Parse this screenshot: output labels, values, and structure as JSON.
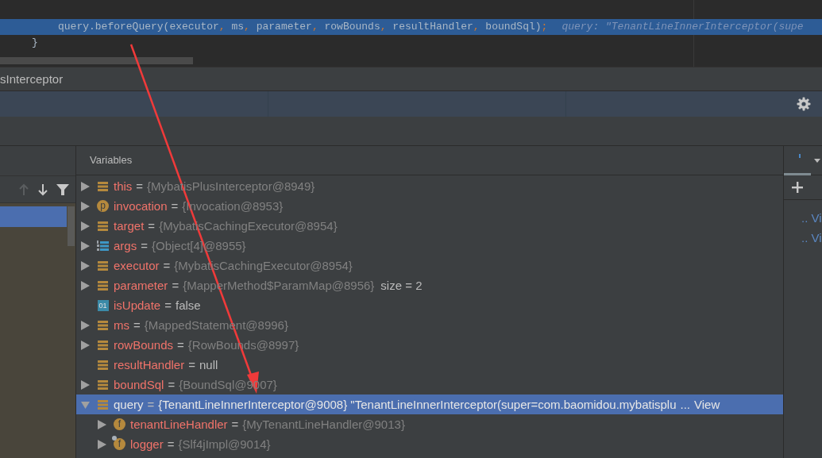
{
  "editor": {
    "lines": [
      {
        "current": true,
        "tokens": [
          {
            "kind": "plain",
            "text": "query.beforeQuery(executor"
          },
          {
            "kind": "comma",
            "text": ","
          },
          {
            "kind": "plain",
            "text": " ms"
          },
          {
            "kind": "comma",
            "text": ","
          },
          {
            "kind": "plain",
            "text": " parameter"
          },
          {
            "kind": "comma",
            "text": ","
          },
          {
            "kind": "plain",
            "text": " rowBounds"
          },
          {
            "kind": "comma",
            "text": ","
          },
          {
            "kind": "plain",
            "text": " resultHandler"
          },
          {
            "kind": "comma",
            "text": ","
          },
          {
            "kind": "plain",
            "text": " boundSql)"
          },
          {
            "kind": "comma",
            "text": ";"
          }
        ],
        "hint": "query: \"TenantLineInnerInterceptor(supe"
      },
      {
        "current": false,
        "tokens": [
          {
            "kind": "plain",
            "text": "}"
          }
        ]
      }
    ]
  },
  "file_tab": {
    "label": "sInterceptor"
  },
  "frames": {
    "rows": [
      {
        "selected": true
      }
    ]
  },
  "variables": {
    "title": "Variables",
    "rows": [
      {
        "name": "this",
        "eq": "=",
        "value": "{MybatisPlusInterceptor@8949}",
        "kind": "object",
        "expanded": false
      },
      {
        "name": "invocation",
        "eq": "=",
        "value": "{Invocation@8953}",
        "kind": "param",
        "icon_text": "p",
        "expanded": false
      },
      {
        "name": "target",
        "eq": "=",
        "value": "{MybatisCachingExecutor@8954}",
        "kind": "object",
        "expanded": false
      },
      {
        "name": "args",
        "eq": "=",
        "value": "{Object[4]@8955}",
        "kind": "array",
        "expanded": false
      },
      {
        "name": "executor",
        "eq": "=",
        "value": "{MybatisCachingExecutor@8954}",
        "kind": "object",
        "expanded": false
      },
      {
        "name": "parameter",
        "eq": "=",
        "value": "{MapperMethod$ParamMap@8956}",
        "extra": "size = 2",
        "kind": "object",
        "expanded": false
      },
      {
        "name": "isUpdate",
        "eq": "=",
        "value": "false",
        "literal": true,
        "kind": "primitive",
        "icon_text": "01"
      },
      {
        "name": "ms",
        "eq": "=",
        "value": "{MappedStatement@8996}",
        "kind": "object",
        "expanded": false
      },
      {
        "name": "rowBounds",
        "eq": "=",
        "value": "{RowBounds@8997}",
        "kind": "object",
        "expanded": false
      },
      {
        "name": "resultHandler",
        "eq": "=",
        "value": "null",
        "literal": true,
        "kind": "object"
      },
      {
        "name": "boundSql",
        "eq": "=",
        "value": "{BoundSql@9007}",
        "kind": "object",
        "expanded": false
      },
      {
        "name": "query",
        "eq": "=",
        "value": "{TenantLineInnerInterceptor@9008} \"TenantLineInnerInterceptor(super=com.baomidou.mybatisplu",
        "more": "...",
        "link": "View",
        "kind": "object",
        "expanded": true,
        "selected": true,
        "children": [
          {
            "name": "tenantLineHandler",
            "eq": "=",
            "value": "{MyTenantLineHandler@9013}",
            "kind": "field",
            "icon_text": "f",
            "expanded": false
          },
          {
            "name": "logger",
            "eq": "=",
            "value": "{Slf4jImpl@9014}",
            "kind": "field",
            "icon_text": "f",
            "static": true,
            "expanded": false
          }
        ]
      }
    ]
  },
  "watches": {
    "items": [
      ".. Vi",
      ".. Vi"
    ]
  }
}
